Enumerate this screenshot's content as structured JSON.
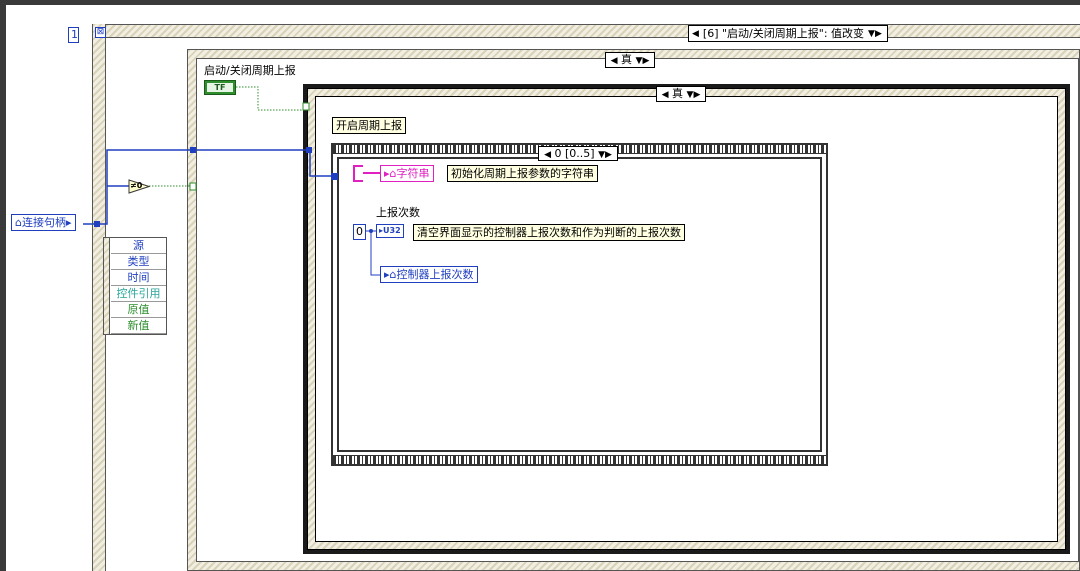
{
  "event_struct": {
    "frame_index": "1",
    "selector": "[6] \"启动/关闭周期上报\": 值改变"
  },
  "outer_case": {
    "selector": "真"
  },
  "inner_case": {
    "selector": "真"
  },
  "sequence": {
    "selector": "0 [0..5]"
  },
  "left": {
    "handle_label": "连接句柄",
    "event_fields": [
      "源",
      "类型",
      "时间",
      "控件引用",
      "原值",
      "新值"
    ],
    "not_equal_zero": "≠0"
  },
  "control": {
    "label": "启动/关闭周期上报",
    "bool_text": "TF"
  },
  "comments": {
    "open_report": "开启周期上报",
    "init_string": "初始化周期上报参数的字符串",
    "clear_counts": "清空界面显示的控制器上报次数和作为判断的上报次数"
  },
  "nodes": {
    "string_local": "字符串",
    "report_count_label": "上报次数",
    "u32_type": "U32",
    "const_zero": "0",
    "ctrl_report_local": "控制器上报次数"
  },
  "colors": {
    "wire_blue": "#1f3fbf",
    "wire_green": "#2f8f2f",
    "string_pink": "#e020c0",
    "cluster_teal": "#2aa59a"
  }
}
